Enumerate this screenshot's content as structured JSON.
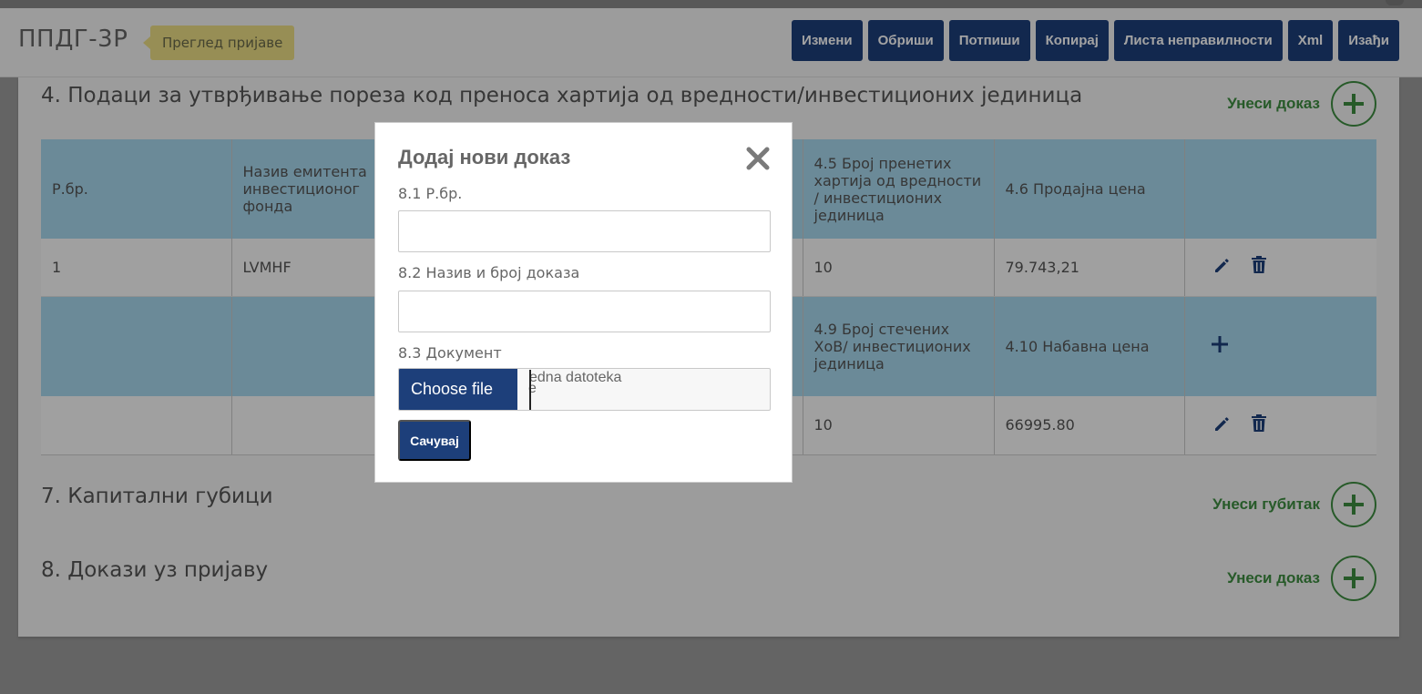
{
  "app": {
    "title": "ППДГ-3Р",
    "badge": "Преглед пријаве"
  },
  "toolbar": {
    "buttons": [
      "Измени",
      "Обриши",
      "Потпиши",
      "Копирај",
      "Листа неправилности",
      "Xml",
      "Изађи"
    ]
  },
  "sections": {
    "s4": {
      "title": "4. Подаци за утврђивање пореза код преноса хартија од вредности/инвестиционих јединица",
      "add_label": "Унеси доказ"
    },
    "s7": {
      "title": "7. Капитални губици",
      "add_label": "Унеси губитак"
    },
    "s8": {
      "title": "8. Докази уз пријаву",
      "add_label": "Унеси доказ"
    }
  },
  "table": {
    "header1": [
      "Р.бр.",
      "Назив емитента инвестиционог фонда",
      "",
      "",
      "4.5 Број пренетих хартија од вредности / инвестиционих јединица",
      "4.6 Продајна цена",
      ""
    ],
    "row1": [
      "1",
      "LVMHF",
      "",
      "",
      "10",
      "79.743,21"
    ],
    "header2": [
      "",
      "",
      "",
      "",
      "4.9 Број стечених ХоВ/ инвестиционих јединица",
      "4.10 Набавна цена"
    ],
    "row2": [
      "",
      "",
      "",
      "",
      "10",
      "66995.80"
    ]
  },
  "modal": {
    "title": "Додај нови доказ",
    "field1_label": "8.1 Р.бр.",
    "field1_value": "",
    "field2_label": "8.2 Назив и број доказа",
    "field2_value": "",
    "field3_label": "8.3 Документ",
    "choose_file": "Choose file",
    "file_status_line1": "edna datoteka",
    "file_status_line2": "e",
    "save_label": "Сачувај"
  },
  "colors": {
    "primary": "#1d3f7a",
    "accent_green": "#3e8e41",
    "header_cell": "#a8d8ee",
    "badge": "#ecdf86"
  },
  "icons": {
    "edit": "pencil-icon",
    "delete": "trash-icon",
    "add": "plus-icon",
    "close": "close-icon"
  }
}
